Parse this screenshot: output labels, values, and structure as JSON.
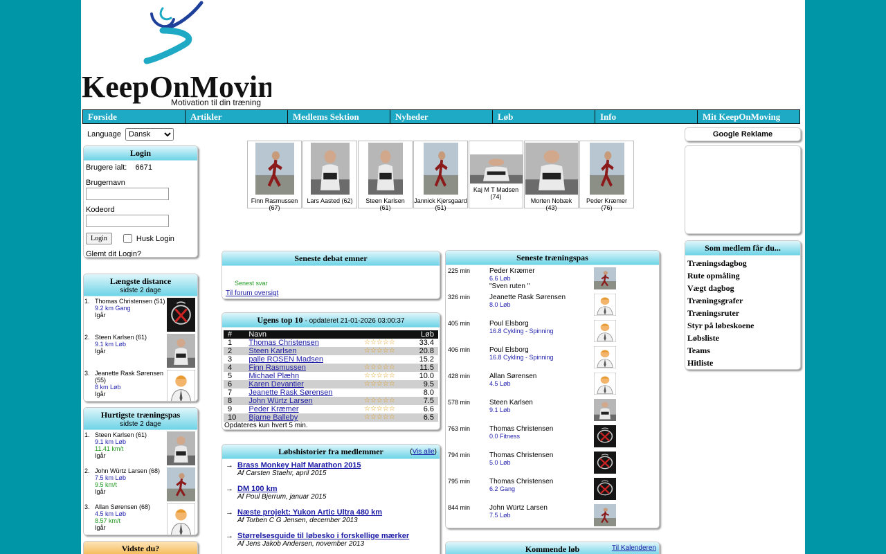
{
  "brand": {
    "name": "KeepOnMoving",
    "tagline": "Motivation til din træning",
    "colors": {
      "teal": "#1ea9c4",
      "orange": "#f5b955",
      "background": "#0096a8"
    }
  },
  "nav": [
    "Forside",
    "Artikler",
    "Medlems Sektion",
    "Nyheder",
    "Løb",
    "Info",
    "Mit KeepOnMoving"
  ],
  "language": {
    "label": "Language",
    "selected": "Dansk"
  },
  "login": {
    "title": "Login",
    "users_label": "Brugere ialt:",
    "users_count": "6671",
    "username_label": "Brugernavn",
    "password_label": "Kodeord",
    "button": "Login",
    "remember": "Husk Login",
    "forgot": "Glemt dit Login?"
  },
  "longest": {
    "title": "Længste distance",
    "subtitle": "sidste 2 dage",
    "items": [
      {
        "num": "1.",
        "name": "Thomas Christensen (51)",
        "dist": "9.2 km Gang",
        "when": "Igår",
        "avatar": "logo"
      },
      {
        "num": "2.",
        "name": "Steen Karlsen (61)",
        "dist": "9.1 km Løb",
        "when": "Igår",
        "avatar": "photo"
      },
      {
        "num": "3.",
        "name": "Jeanette Rask Sørensen (55)",
        "dist": "8 km Løb",
        "when": "Igår",
        "avatar": "default"
      }
    ]
  },
  "fastest": {
    "title": "Hurtigste træningspas",
    "subtitle": "sidste 2 dage",
    "items": [
      {
        "num": "1.",
        "name": "Steen Karlsen (61)",
        "dist": "9.1 km Løb",
        "speed": "11.41 km/t",
        "when": "Igår",
        "avatar": "photo"
      },
      {
        "num": "2.",
        "name": "John Würtz Larsen (68)",
        "dist": "7.5 km Løb",
        "speed": "9.5 km/t",
        "when": "Igår",
        "avatar": "runner"
      },
      {
        "num": "3.",
        "name": "Allan Sørensen (68)",
        "dist": "4.5 km Løb",
        "speed": "8.57 km/t",
        "when": "Igår",
        "avatar": "default"
      }
    ]
  },
  "did_you_know": {
    "title": "Vidste du?"
  },
  "gallery": [
    {
      "name": "Finn Rasmussen",
      "age": "(67)"
    },
    {
      "name": "Lars Aasted (62)",
      "age": ""
    },
    {
      "name": "Steen Karlsen",
      "age": "(61)"
    },
    {
      "name": "Jannick Kjersgaard (51)",
      "age": ""
    },
    {
      "name": "Kaj M T Madsen",
      "age": "(74)"
    },
    {
      "name": "Morten Nobæk",
      "age": "(43)"
    },
    {
      "name": "Peder Kræmer",
      "age": "(76)"
    }
  ],
  "debate": {
    "title": "Seneste debat emner",
    "last_reply": "Senest svar",
    "overview_link": "Til forum oversigt"
  },
  "top10": {
    "title": "Ugens top 10",
    "updated": "- opdateret 21-01-2026 03:00:37",
    "col_num": "#",
    "col_name": "Navn",
    "col_run": "Løb",
    "rows": [
      {
        "n": "1",
        "name": "Thomas Christensen",
        "stars": "☆☆☆☆☆",
        "km": "33.4"
      },
      {
        "n": "2",
        "name": "Steen Karlsen",
        "stars": "☆☆☆☆☆",
        "km": "20.8"
      },
      {
        "n": "3",
        "name": "palle ROSEN Madsen",
        "stars": "",
        "km": "15.2"
      },
      {
        "n": "4",
        "name": "Finn Rasmussen",
        "stars": "☆☆☆☆☆",
        "km": "11.5"
      },
      {
        "n": "5",
        "name": "Michael Plæhn",
        "stars": "☆☆☆☆☆",
        "km": "10.0"
      },
      {
        "n": "6",
        "name": "Karen Devantier",
        "stars": "☆☆☆☆☆",
        "km": "9.5"
      },
      {
        "n": "7",
        "name": "Jeanette Rask Sørensen",
        "stars": "",
        "km": "8.0"
      },
      {
        "n": "8",
        "name": "John Würtz Larsen",
        "stars": "☆☆☆☆☆",
        "km": "7.5"
      },
      {
        "n": "9",
        "name": "Peder Kræmer",
        "stars": "☆☆☆☆☆",
        "km": "6.6"
      },
      {
        "n": "10",
        "name": "Bjarne Balleby",
        "stars": "☆☆☆☆☆",
        "km": "6.5"
      }
    ],
    "note": "Opdateres kun hvert 5 min."
  },
  "stories": {
    "title": "Løbshistorier fra medlemmer",
    "show_all": "Vis alle",
    "items": [
      {
        "title": "Brass Monkey Half Marathon 2015",
        "author": "Af Carsten Staehr, april 2015"
      },
      {
        "title": "DM 100 km",
        "author": "Af Poul Bjerrum, januar 2015"
      },
      {
        "title": "Næste projekt: Yukon Artic Ultra 480 km",
        "author": "Af Torben C G Jensen, december 2013"
      },
      {
        "title": "Størrelsesguide til løbesko i forskellige mærker",
        "author": "Af Jens Jakob Andersen, november 2013"
      }
    ]
  },
  "training": {
    "title": "Seneste træningspas",
    "items": [
      {
        "min": "225 min",
        "name": "Peder Kræmer",
        "detail": "6.6 Løb",
        "note": "\"Sven ruten \"",
        "avatar": "runner"
      },
      {
        "min": "326 min",
        "name": "Jeanette Rask Sørensen",
        "detail": "8.0 Løb",
        "note": "",
        "avatar": "default"
      },
      {
        "min": "405 min",
        "name": "Poul Elsborg",
        "detail": "16.8 Cykling - Spinning",
        "note": "",
        "avatar": "default"
      },
      {
        "min": "406 min",
        "name": "Poul Elsborg",
        "detail": "16.8 Cykling - Spinning",
        "note": "",
        "avatar": "default"
      },
      {
        "min": "428 min",
        "name": "Allan Sørensen",
        "detail": "4.5 Løb",
        "note": "",
        "avatar": "default"
      },
      {
        "min": "578 min",
        "name": "Steen Karlsen",
        "detail": "9.1 Løb",
        "note": "",
        "avatar": "photo"
      },
      {
        "min": "763 min",
        "name": "Thomas Christensen",
        "detail": "0.0 Fitness",
        "note": "",
        "avatar": "logo"
      },
      {
        "min": "794 min",
        "name": "Thomas Christensen",
        "detail": "5.0 Løb",
        "note": "",
        "avatar": "logo"
      },
      {
        "min": "795 min",
        "name": "Thomas Christensen",
        "detail": "6.2 Gang",
        "note": "",
        "avatar": "logo"
      },
      {
        "min": "844 min",
        "name": "John Würtz Larsen",
        "detail": "7.5 Løb",
        "note": "",
        "avatar": "runner"
      }
    ]
  },
  "upcoming": {
    "title": "Kommende løb",
    "calendar_link": "Til Kalenderen"
  },
  "ads": {
    "title": "Google Reklame"
  },
  "benefits": {
    "title": "Som medlem får du...",
    "items": [
      "Træningsdagbog",
      "Rute opmåling",
      "Vægt dagbog",
      "Træningsgrafer",
      "Træningsruter",
      "Styr på løbeskoene",
      "Løbsliste",
      "Teams",
      "Hitliste"
    ]
  }
}
